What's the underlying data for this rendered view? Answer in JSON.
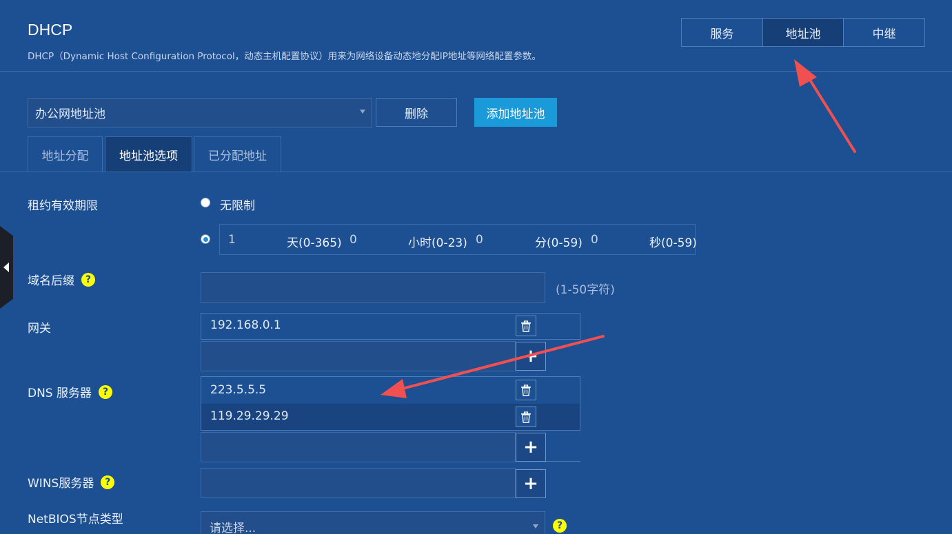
{
  "header": {
    "title": "DHCP",
    "description": "DHCP（Dynamic Host Configuration Protocol，动态主机配置协议）用来为网络设备动态地分配IP地址等网络配置参数。"
  },
  "top_tabs": [
    {
      "label": "服务",
      "active": false
    },
    {
      "label": "地址池",
      "active": true
    },
    {
      "label": "中继",
      "active": false
    }
  ],
  "pool": {
    "selected": "办公网地址池",
    "delete_label": "删除",
    "add_label": "添加地址池"
  },
  "sub_tabs": [
    {
      "label": "地址分配",
      "active": false
    },
    {
      "label": "地址池选项",
      "active": true
    },
    {
      "label": "已分配地址",
      "active": false
    }
  ],
  "lease": {
    "label": "租约有效期限",
    "unlimited_label": "无限制",
    "unlimited_selected": false,
    "custom_selected": true,
    "days": "1",
    "days_unit": "天(0-365)",
    "hours": "0",
    "hours_unit": "小时(0-23)",
    "minutes": "0",
    "minutes_unit": "分(0-59)",
    "seconds": "0",
    "seconds_unit": "秒(0-59)"
  },
  "domain_suffix": {
    "label": "域名后缀",
    "value": "",
    "hint": "(1-50字符)"
  },
  "gateway": {
    "label": "网关",
    "entries": [
      "192.168.0.1"
    ]
  },
  "dns": {
    "label": "DNS 服务器",
    "entries": [
      "223.5.5.5",
      "119.29.29.29"
    ]
  },
  "wins": {
    "label": "WINS服务器"
  },
  "netbios": {
    "label": "NetBIOS节点类型",
    "placeholder": "请选择..."
  },
  "help_glyph": "?",
  "plus_glyph": "+",
  "colors": {
    "background": "#1d4f93",
    "accent_button": "#1a9ad8",
    "active_tab": "#163f78",
    "help_icon": "#ffff00",
    "annotation_arrow": "#f05050"
  }
}
